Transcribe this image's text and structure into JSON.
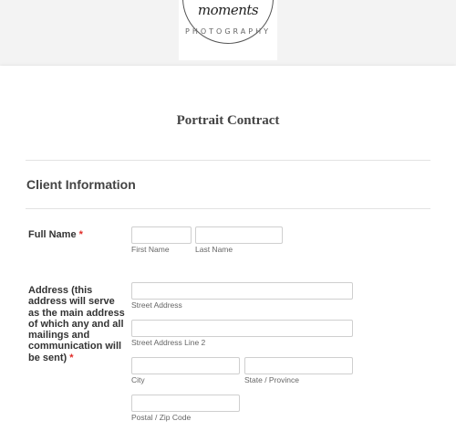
{
  "logo": {
    "script_text": "moments",
    "sub_text": "PHOTOGRAPHY"
  },
  "form": {
    "title": "Portrait Contract",
    "section_title": "Client Information",
    "required_mark": "*",
    "full_name": {
      "label": "Full Name",
      "first_value": "",
      "last_value": "",
      "first_sublabel": "First Name",
      "last_sublabel": "Last Name"
    },
    "address": {
      "label": "Address (this address will serve as the main address of which any and all mailings and communication will be sent)",
      "street_sublabel": "Street Address",
      "street2_sublabel": "Street Address Line 2",
      "city_sublabel": "City",
      "state_sublabel": "State / Province",
      "zip_sublabel": "Postal / Zip Code",
      "street_value": "",
      "street2_value": "",
      "city_value": "",
      "state_value": "",
      "zip_value": ""
    }
  },
  "colors": {
    "required": "#e02b27",
    "page_bg": "#f3f3f3",
    "card_bg": "#ffffff"
  }
}
